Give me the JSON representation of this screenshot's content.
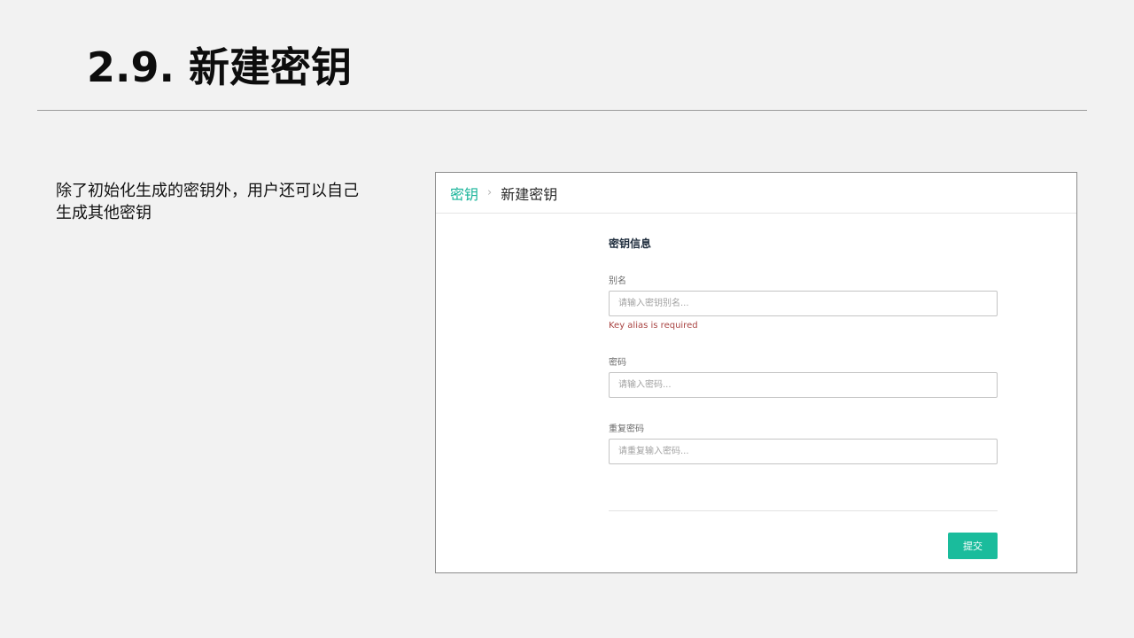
{
  "slide": {
    "title": "2.9. 新建密钥",
    "description": "除了初始化生成的密钥外，用户还可以自己生成其他密钥"
  },
  "breadcrumb": {
    "parent": "密钥",
    "separator": "›",
    "current": "新建密钥"
  },
  "form": {
    "section_title": "密钥信息",
    "alias": {
      "label": "别名",
      "placeholder": "请输入密钥别名...",
      "value": "",
      "error": "Key alias is required"
    },
    "password": {
      "label": "密码",
      "placeholder": "请输入密码...",
      "value": ""
    },
    "repeat_password": {
      "label": "重复密码",
      "placeholder": "请重复输入密码...",
      "value": ""
    },
    "submit_label": "提交"
  },
  "colors": {
    "accent": "#1abc9c",
    "error": "#a94442",
    "background": "#f2f2f2"
  }
}
